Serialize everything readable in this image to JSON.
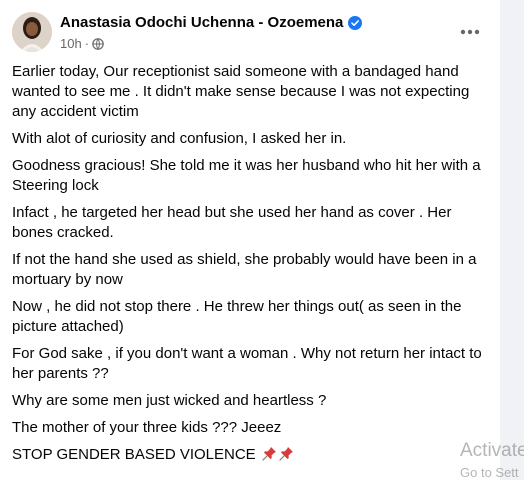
{
  "post": {
    "author": "Anastasia Odochi Uchenna - Ozoemena",
    "time": "10h",
    "separator": "·",
    "verified_icon": "verified-badge-icon",
    "privacy_icon": "globe-icon",
    "more_icon": "more-options-icon",
    "colors": {
      "verified": "#1877f2",
      "text": "#050505",
      "meta": "#65676b"
    },
    "paragraphs": [
      "Earlier today, Our receptionist said someone with a bandaged hand wanted to see me . It didn't make sense because I was not expecting any accident victim",
      "With alot of  curiosity and confusion, I asked her in.",
      "Goodness gracious! She told me it was her husband who hit her with a Steering lock",
      "Infact , he targeted her head but she used her hand as cover . Her bones cracked.",
      "If not the hand she used as shield, she probably would have been in a mortuary by now",
      "Now , he did not stop there . He threw her things out( as seen in the picture attached)",
      "For God sake , if you don't want a woman . Why not return her intact to her parents ??",
      "Why are some men just wicked and heartless ?",
      "The mother of your three kids ??? Jeeez",
      "STOP GENDER BASED VIOLENCE"
    ],
    "last_line_icons": [
      "pushpin-icon",
      "pushpin-icon"
    ]
  },
  "watermark": {
    "line1": "Activate",
    "line2": "Go to Sett"
  }
}
